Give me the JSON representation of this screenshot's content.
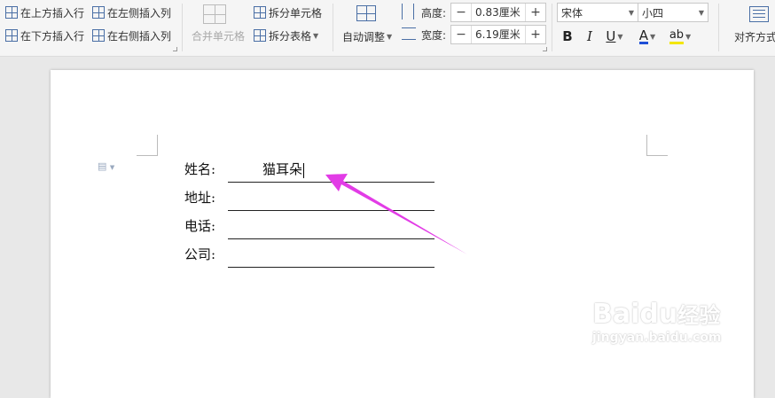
{
  "ribbon": {
    "insert_above": "在上方插入行",
    "insert_below": "在下方插入行",
    "insert_left": "在左侧插入列",
    "insert_right": "在右侧插入列",
    "merge_cells": "合并单元格",
    "split_cells": "拆分单元格",
    "split_table": "拆分表格",
    "auto_adjust": "自动调整",
    "height_label": "高度:",
    "height_value": "0.83厘米",
    "width_label": "宽度:",
    "width_value": "6.19厘米",
    "font_name": "宋体",
    "font_size": "小四",
    "align_label": "对齐方式",
    "minus": "−",
    "plus": "+",
    "bold": "B",
    "italic": "I",
    "underline": "U",
    "font_color": "A",
    "highlight": "ab"
  },
  "form": {
    "name_label": "姓名:",
    "name_value": "猫耳朵",
    "address_label": "地址:",
    "phone_label": "电话:",
    "company_label": "公司:"
  },
  "watermark": {
    "brand": "Bai",
    "brand2": "du",
    "suffix": "经验",
    "url": "jingyan.baidu.com"
  },
  "colors": {
    "arrow": "#e23ce6",
    "font_color_bar": "#1f4fd6",
    "highlight_bar": "#f3e600"
  }
}
